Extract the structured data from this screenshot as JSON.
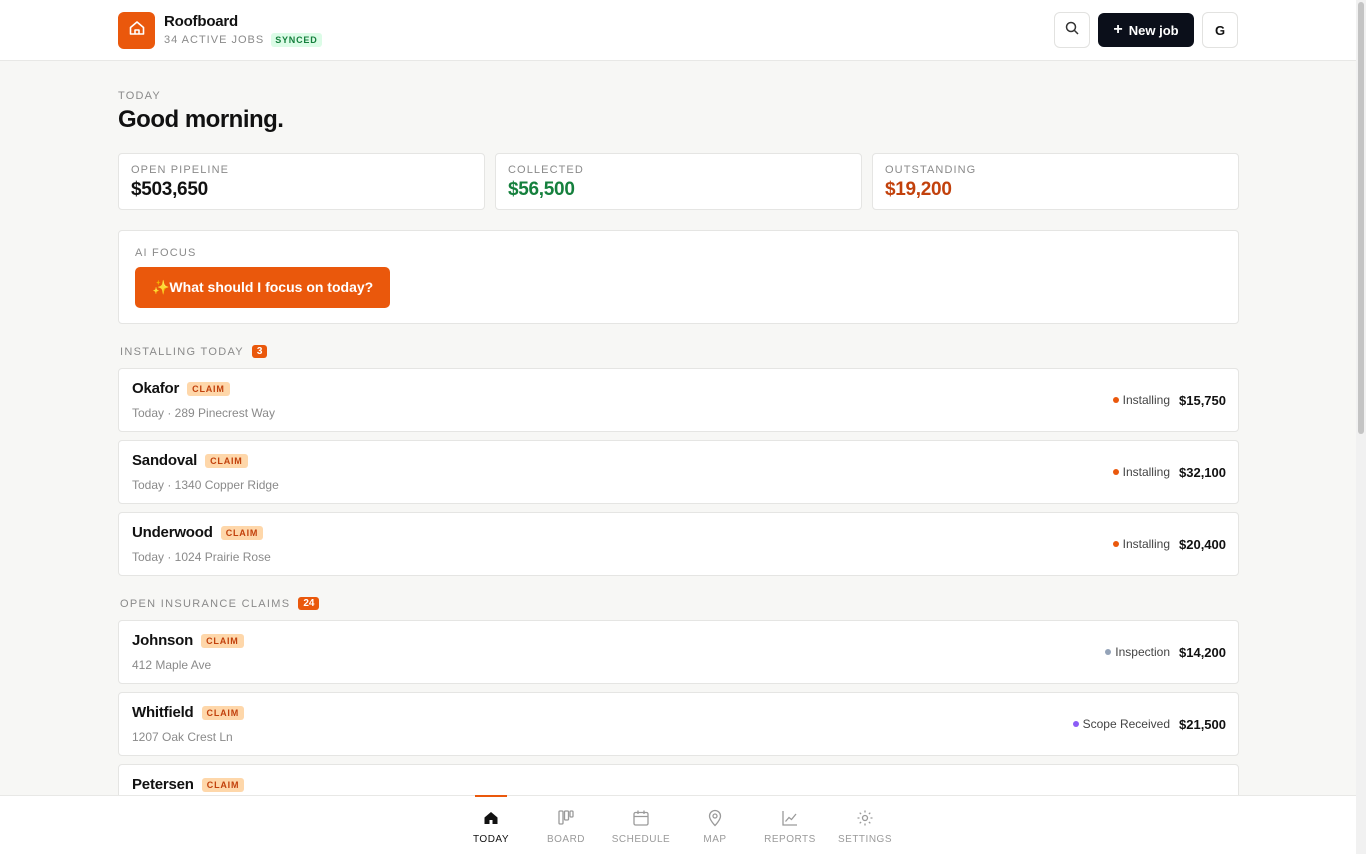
{
  "app": {
    "name": "Roofboard",
    "subtitle": "34 ACTIVE JOBS",
    "sync_status": "SYNCED",
    "new_job_label": "New job",
    "avatar_initial": "G",
    "accent_color": "#ea580c"
  },
  "greeting": {
    "eyebrow": "TODAY",
    "title": "Good morning."
  },
  "stats": [
    {
      "label": "OPEN PIPELINE",
      "value": "$503,650",
      "color": "#111111"
    },
    {
      "label": "COLLECTED",
      "value": "$56,500",
      "color": "#15803d"
    },
    {
      "label": "OUTSTANDING",
      "value": "$19,200",
      "color": "#c2410c"
    }
  ],
  "ai_focus": {
    "label": "AI FOCUS",
    "button_label": "✨What should I focus on today?"
  },
  "sections": [
    {
      "title": "INSTALLING TODAY",
      "count": "3",
      "jobs": [
        {
          "name": "Okafor",
          "tag": "CLAIM",
          "detail": "Today · 289 Pinecrest Way",
          "status": "Installing",
          "status_color": "#ea580c",
          "amount": "$15,750"
        },
        {
          "name": "Sandoval",
          "tag": "CLAIM",
          "detail": "Today · 1340 Copper Ridge",
          "status": "Installing",
          "status_color": "#ea580c",
          "amount": "$32,100"
        },
        {
          "name": "Underwood",
          "tag": "CLAIM",
          "detail": "Today · 1024 Prairie Rose",
          "status": "Installing",
          "status_color": "#ea580c",
          "amount": "$20,400"
        }
      ]
    },
    {
      "title": "OPEN INSURANCE CLAIMS",
      "count": "24",
      "jobs": [
        {
          "name": "Johnson",
          "tag": "CLAIM",
          "detail": "412 Maple Ave",
          "status": "Inspection",
          "status_color": "#94a3b8",
          "amount": "$14,200"
        },
        {
          "name": "Whitfield",
          "tag": "CLAIM",
          "detail": "1207 Oak Crest Ln",
          "status": "Scope Received",
          "status_color": "#8b5cf6",
          "amount": "$21,500"
        },
        {
          "name": "Petersen",
          "tag": "CLAIM",
          "detail": "",
          "status": "",
          "status_color": "#0ea5e9",
          "amount": ""
        }
      ]
    }
  ],
  "nav": [
    {
      "label": "TODAY",
      "icon": "home-icon",
      "active": true
    },
    {
      "label": "BOARD",
      "icon": "board-icon",
      "active": false
    },
    {
      "label": "SCHEDULE",
      "icon": "calendar-icon",
      "active": false
    },
    {
      "label": "MAP",
      "icon": "map-pin-icon",
      "active": false
    },
    {
      "label": "REPORTS",
      "icon": "chart-icon",
      "active": false
    },
    {
      "label": "SETTINGS",
      "icon": "gear-icon",
      "active": false
    }
  ]
}
